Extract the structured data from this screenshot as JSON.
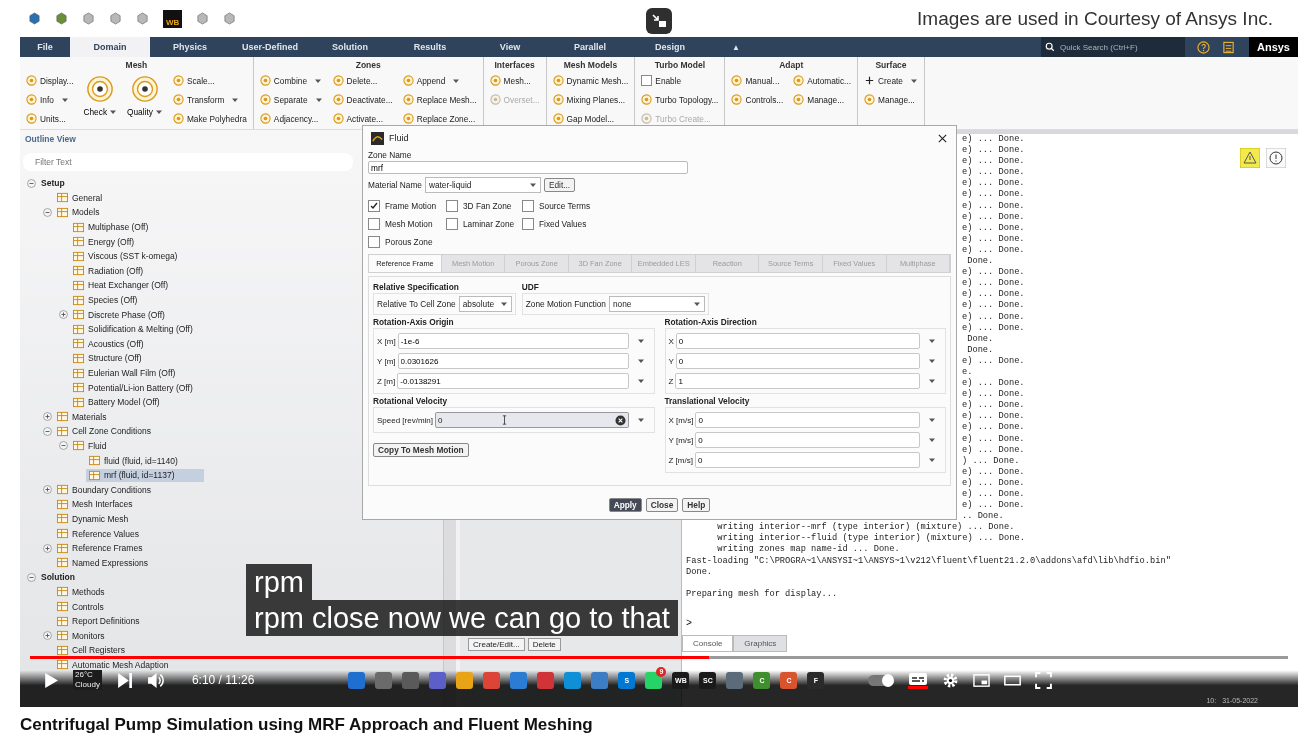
{
  "top_bar": {
    "workbench_label": "WB",
    "courtesy_note": "Images are used in Courtesy of Ansys Inc."
  },
  "menu_tabs": [
    {
      "label": "File",
      "selected": false
    },
    {
      "label": "Domain",
      "selected": true
    },
    {
      "label": "Physics",
      "selected": false
    },
    {
      "label": "User-Defined",
      "selected": false
    },
    {
      "label": "Solution",
      "selected": false
    },
    {
      "label": "Results",
      "selected": false
    },
    {
      "label": "View",
      "selected": false
    },
    {
      "label": "Parallel",
      "selected": false
    },
    {
      "label": "Design",
      "selected": false
    }
  ],
  "ribbon_toggle": "▲",
  "quick_search": {
    "placeholder": "Quick Search (Ctrl+F)"
  },
  "brand": "Ansys",
  "ribbon": [
    {
      "title": "Mesh",
      "columns": [
        [
          {
            "label": "Display...",
            "kind": "tool",
            "disabled": false
          },
          {
            "label": "Info",
            "kind": "menu_tool",
            "disabled": false
          },
          {
            "label": "Units...",
            "kind": "tool",
            "disabled": false
          }
        ],
        [
          {
            "label": "Check",
            "kind": "large",
            "disabled": false
          }
        ],
        [
          {
            "label": "Quality",
            "kind": "large",
            "disabled": false
          }
        ],
        [
          {
            "label": "Scale...",
            "kind": "tool",
            "disabled": false
          },
          {
            "label": "Transform",
            "kind": "menu_tool",
            "disabled": false
          },
          {
            "label": "Make Polyhedra",
            "kind": "tool",
            "disabled": false
          }
        ]
      ]
    },
    {
      "title": "Zones",
      "columns": [
        [
          {
            "label": "Combine",
            "kind": "menu_tool",
            "disabled": false
          },
          {
            "label": "Separate",
            "kind": "menu_tool",
            "disabled": false
          },
          {
            "label": "Adjacency...",
            "kind": "tool",
            "disabled": false
          }
        ],
        [
          {
            "label": "Delete...",
            "kind": "tool",
            "disabled": false
          },
          {
            "label": "Deactivate...",
            "kind": "tool",
            "disabled": false
          },
          {
            "label": "Activate...",
            "kind": "tool",
            "disabled": false
          }
        ],
        [
          {
            "label": "Append",
            "kind": "menu_tool",
            "disabled": false
          },
          {
            "label": "Replace Mesh...",
            "kind": "tool",
            "disabled": false
          },
          {
            "label": "Replace Zone...",
            "kind": "tool",
            "disabled": false
          }
        ]
      ]
    },
    {
      "title": "Interfaces",
      "columns": [
        [
          {
            "label": "Mesh...",
            "kind": "tool",
            "disabled": false
          },
          {
            "label": "Overset...",
            "kind": "tool",
            "disabled": true
          }
        ]
      ]
    },
    {
      "title": "Mesh Models",
      "columns": [
        [
          {
            "label": "Dynamic Mesh...",
            "kind": "tool",
            "disabled": false
          },
          {
            "label": "Mixing Planes...",
            "kind": "tool",
            "disabled": false
          },
          {
            "label": "Gap Model...",
            "kind": "tool",
            "disabled": false
          }
        ]
      ]
    },
    {
      "title": "Turbo Model",
      "columns": [
        [
          {
            "label": "Enable",
            "kind": "check",
            "checked": false,
            "disabled": false
          },
          {
            "label": "Turbo Topology...",
            "kind": "tool",
            "disabled": false
          },
          {
            "label": "Turbo Create...",
            "kind": "tool",
            "disabled": true
          }
        ]
      ]
    },
    {
      "title": "Adapt",
      "columns": [
        [
          {
            "label": "Manual...",
            "kind": "tool",
            "disabled": false
          },
          {
            "label": "Controls...",
            "kind": "tool",
            "disabled": false
          }
        ],
        [
          {
            "label": "Automatic...",
            "kind": "tool",
            "disabled": false
          },
          {
            "label": "Manage...",
            "kind": "tool",
            "disabled": false
          }
        ]
      ]
    },
    {
      "title": "Surface",
      "columns": [
        [
          {
            "label": "Create",
            "kind": "add_menu",
            "disabled": false
          },
          {
            "label": "Manage...",
            "kind": "tool",
            "disabled": false
          }
        ]
      ]
    }
  ],
  "outline": {
    "title": "Outline View",
    "filter": {
      "placeholder": "Filter Text"
    },
    "tree": [
      {
        "label": "Setup",
        "kind": "section",
        "expanded": true,
        "selected": false,
        "children": [
          {
            "label": "General",
            "kind": "item",
            "selected": false
          },
          {
            "label": "Models",
            "kind": "item",
            "expanded": true,
            "selected": false,
            "children": [
              {
                "label": "Multiphase (Off)",
                "kind": "item",
                "selected": false
              },
              {
                "label": "Energy (Off)",
                "kind": "item",
                "selected": false
              },
              {
                "label": "Viscous (SST k-omega)",
                "kind": "item",
                "selected": false
              },
              {
                "label": "Radiation (Off)",
                "kind": "item",
                "selected": false
              },
              {
                "label": "Heat Exchanger (Off)",
                "kind": "item",
                "selected": false
              },
              {
                "label": "Species (Off)",
                "kind": "item",
                "selected": false
              },
              {
                "label": "Discrete Phase (Off)",
                "kind": "item",
                "expanded": false,
                "selected": false
              },
              {
                "label": "Solidification & Melting (Off)",
                "kind": "item",
                "selected": false
              },
              {
                "label": "Acoustics (Off)",
                "kind": "item",
                "selected": false
              },
              {
                "label": "Structure (Off)",
                "kind": "item",
                "selected": false
              },
              {
                "label": "Eulerian Wall Film (Off)",
                "kind": "item",
                "selected": false
              },
              {
                "label": "Potential/Li-ion Battery (Off)",
                "kind": "item",
                "selected": false
              },
              {
                "label": "Battery Model (Off)",
                "kind": "item",
                "selected": false
              }
            ]
          },
          {
            "label": "Materials",
            "kind": "item",
            "expanded": false,
            "selected": false
          },
          {
            "label": "Cell Zone Conditions",
            "kind": "item",
            "expanded": true,
            "selected": false,
            "children": [
              {
                "label": "Fluid",
                "kind": "item",
                "expanded": true,
                "selected": false,
                "children": [
                  {
                    "label": "fluid (fluid, id=1140)",
                    "kind": "item",
                    "selected": false
                  },
                  {
                    "label": "mrf (fluid, id=1137)",
                    "kind": "item",
                    "selected": true
                  }
                ]
              }
            ]
          },
          {
            "label": "Boundary Conditions",
            "kind": "item",
            "expanded": false,
            "selected": false
          },
          {
            "label": "Mesh Interfaces",
            "kind": "item",
            "selected": false
          },
          {
            "label": "Dynamic Mesh",
            "kind": "item",
            "selected": false
          },
          {
            "label": "Reference Values",
            "kind": "item",
            "selected": false
          },
          {
            "label": "Reference Frames",
            "kind": "item",
            "expanded": false,
            "selected": false
          },
          {
            "label": "Named Expressions",
            "kind": "item",
            "selected": false
          }
        ]
      },
      {
        "label": "Solution",
        "kind": "section",
        "expanded": true,
        "selected": false,
        "children": [
          {
            "label": "Methods",
            "kind": "item",
            "selected": false
          },
          {
            "label": "Controls",
            "kind": "item",
            "selected": false
          },
          {
            "label": "Report Definitions",
            "kind": "item",
            "selected": false
          },
          {
            "label": "Monitors",
            "kind": "item",
            "expanded": false,
            "selected": false
          },
          {
            "label": "Cell Registers",
            "kind": "item",
            "selected": false
          },
          {
            "label": "Automatic Mesh Adaption",
            "kind": "item",
            "selected": false
          }
        ]
      }
    ]
  },
  "task_page": {
    "buttons": [
      "Create/Edit...",
      "Delete"
    ]
  },
  "console": {
    "lines": [
      {
        "kind": "fragment",
        "text": "e) ... Done."
      },
      {
        "kind": "fragment",
        "text": "e) ... Done."
      },
      {
        "kind": "fragment",
        "text": "e) ... Done."
      },
      {
        "kind": "fragment",
        "text": "e) ... Done."
      },
      {
        "kind": "fragment",
        "text": "e) ... Done."
      },
      {
        "kind": "fragment",
        "text": "e) ... Done."
      },
      {
        "kind": "fragment",
        "text": "e) ... Done."
      },
      {
        "kind": "fragment",
        "text": "e) ... Done."
      },
      {
        "kind": "fragment",
        "text": "e) ... Done."
      },
      {
        "kind": "fragment",
        "text": "e) ... Done."
      },
      {
        "kind": "fragment",
        "text": "e) ... Done."
      },
      {
        "kind": "fragment",
        "text": " Done."
      },
      {
        "kind": "fragment",
        "text": "e) ... Done."
      },
      {
        "kind": "fragment",
        "text": "e) ... Done."
      },
      {
        "kind": "fragment",
        "text": "e) ... Done."
      },
      {
        "kind": "fragment",
        "text": "e) ... Done."
      },
      {
        "kind": "fragment",
        "text": "e) ... Done."
      },
      {
        "kind": "fragment",
        "text": "e) ... Done."
      },
      {
        "kind": "fragment",
        "text": " Done."
      },
      {
        "kind": "fragment",
        "text": " Done."
      },
      {
        "kind": "fragment",
        "text": "e) ... Done."
      },
      {
        "kind": "fragment",
        "text": "e."
      },
      {
        "kind": "fragment",
        "text": "e) ... Done."
      },
      {
        "kind": "fragment",
        "text": "e) ... Done."
      },
      {
        "kind": "fragment",
        "text": "e) ... Done."
      },
      {
        "kind": "fragment",
        "text": "e) ... Done."
      },
      {
        "kind": "fragment",
        "text": "e) ... Done."
      },
      {
        "kind": "fragment",
        "text": "e) ... Done."
      },
      {
        "kind": "fragment",
        "text": "e) ... Done."
      },
      {
        "kind": "fragment",
        "text": ") ... Done."
      },
      {
        "kind": "fragment",
        "text": "e) ... Done."
      },
      {
        "kind": "fragment",
        "text": "e) ... Done."
      },
      {
        "kind": "fragment",
        "text": "e) ... Done."
      },
      {
        "kind": "fragment",
        "text": "e) ... Done."
      },
      {
        "kind": "fragment",
        "text": ".. Done."
      },
      {
        "kind": "line",
        "text": "      writing interior--mrf (type interior) (mixture) ... Done."
      },
      {
        "kind": "line",
        "text": "      writing interior--fluid (type interior) (mixture) ... Done."
      },
      {
        "kind": "line",
        "text": "      writing zones map name-id ... Done."
      },
      {
        "kind": "line",
        "text": "Fast-loading \"C:\\PROGRA~1\\ANSYSI~1\\ANSYS~1\\v212\\fluent\\fluent21.2.0\\addons\\afd\\lib\\hdfio.bin\""
      },
      {
        "kind": "line",
        "text": "Done."
      },
      {
        "kind": "blank"
      },
      {
        "kind": "line",
        "text": "Preparing mesh for display..."
      }
    ],
    "prompt": ">",
    "tabs": [
      {
        "label": "Console",
        "selected": true
      },
      {
        "label": "Graphics",
        "selected": false
      }
    ]
  },
  "dialog": {
    "title": "Fluid",
    "zone_name_label": "Zone Name",
    "zone_name": "mrf",
    "material_label": "Material Name",
    "material": "water-liquid",
    "edit_button": "Edit...",
    "options": [
      {
        "label": "Frame Motion",
        "checked": true
      },
      {
        "label": "3D Fan Zone",
        "checked": false
      },
      {
        "label": "Source Terms",
        "checked": false
      },
      {
        "label": "Mesh Motion",
        "checked": false
      },
      {
        "label": "Laminar Zone",
        "checked": false
      },
      {
        "label": "Fixed Values",
        "checked": false
      },
      {
        "label": "Porous Zone",
        "checked": false
      }
    ],
    "tabs": [
      {
        "label": "Reference Frame",
        "selected": true,
        "disabled": false
      },
      {
        "label": "Mesh Motion",
        "selected": false,
        "disabled": true
      },
      {
        "label": "Porous Zone",
        "selected": false,
        "disabled": true
      },
      {
        "label": "3D Fan Zone",
        "selected": false,
        "disabled": true
      },
      {
        "label": "Embedded LES",
        "selected": false,
        "disabled": true
      },
      {
        "label": "Reaction",
        "selected": false,
        "disabled": true
      },
      {
        "label": "Source Terms",
        "selected": false,
        "disabled": true
      },
      {
        "label": "Fixed Values",
        "selected": false,
        "disabled": true
      },
      {
        "label": "Multiphase",
        "selected": false,
        "disabled": true
      }
    ],
    "relative": {
      "heading": "Relative Specification",
      "label": "Relative To Cell Zone",
      "value": "absolute"
    },
    "udf": {
      "heading": "UDF",
      "label": "Zone Motion Function",
      "value": "none"
    },
    "origin": {
      "heading": "Rotation-Axis Origin",
      "fields": [
        {
          "label": "X [m]",
          "value": "-1e-6"
        },
        {
          "label": "Y [m]",
          "value": "0.0301626"
        },
        {
          "label": "Z [m]",
          "value": "-0.0138291"
        }
      ]
    },
    "direction": {
      "heading": "Rotation-Axis Direction",
      "fields": [
        {
          "label": "X",
          "value": "0"
        },
        {
          "label": "Y",
          "value": "0"
        },
        {
          "label": "Z",
          "value": "1"
        }
      ]
    },
    "rotational": {
      "heading": "Rotational Velocity",
      "label": "Speed [rev/min]",
      "value": "0",
      "copy_button": "Copy To Mesh Motion"
    },
    "translational": {
      "heading": "Translational Velocity",
      "fields": [
        {
          "label": "X [m/s]",
          "value": "0"
        },
        {
          "label": "Y [m/s]",
          "value": "0"
        },
        {
          "label": "Z [m/s]",
          "value": "0"
        }
      ]
    },
    "buttons": [
      {
        "label": "Apply",
        "kind": "primary"
      },
      {
        "label": "Close",
        "kind": "normal"
      },
      {
        "label": "Help",
        "kind": "normal"
      }
    ]
  },
  "subtitles": [
    "rpm",
    "rpm close now we can go to that"
  ],
  "player": {
    "level": 0.54,
    "time": "6:10 / 11:26",
    "autoplay_on": true,
    "captions_on": true
  },
  "taskbar": {
    "weather": {
      "temperature": "26°C",
      "condition": "Cloudy"
    },
    "apps": [
      {
        "color": "#1f6fd1"
      },
      {
        "color": "#6b6b6b"
      },
      {
        "color": "#5a5a5a"
      },
      {
        "color": "#5b5fc7"
      },
      {
        "color": "#e8a317"
      },
      {
        "color": "#db4437"
      },
      {
        "color": "#2b7cd3"
      },
      {
        "color": "#d13438"
      },
      {
        "color": "#0f8fd6"
      },
      {
        "color": "#3c7dc4"
      },
      {
        "color": "#0078d4",
        "label": "S"
      },
      {
        "color": "#25d366",
        "badge": "9"
      },
      {
        "color": "#1a1a1a",
        "label": "WB"
      },
      {
        "color": "#1a1a1a",
        "label": "SC"
      },
      {
        "color": "#5c6b7a"
      },
      {
        "color": "#3f8f2f",
        "label": "C"
      },
      {
        "color": "#d9532c",
        "label": "C"
      },
      {
        "color": "#2a2a2a",
        "label": "F"
      }
    ],
    "time": "10:",
    "date": "31-05-2022"
  },
  "video_title": "Centrifugal Pump Simulation using MRF Approach and Fluent Meshing"
}
